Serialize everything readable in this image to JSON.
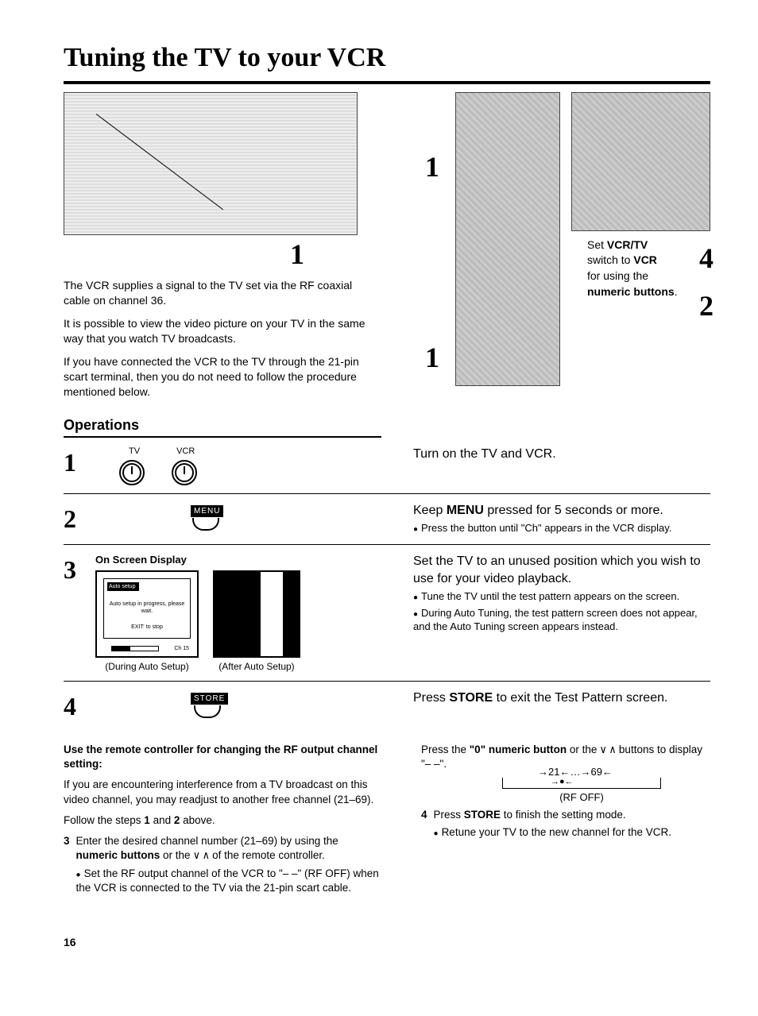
{
  "title": "Tuning the TV to your VCR",
  "intro": {
    "p1": "The VCR supplies a signal to the TV set via the RF coaxial cable on channel 36.",
    "p2": "It is possible to view the video picture on your TV in the same way that you watch TV broadcasts.",
    "p3": "If you have connected the VCR to the TV through the 21-pin scart terminal, then you do not need to follow the procedure mentioned below."
  },
  "side_note": {
    "line1_pre": "Set ",
    "line1_bold": "VCR/TV",
    "line2_pre": "switch to ",
    "line2_bold": "VCR",
    "line3": "for using the",
    "line4_bold": "numeric buttons",
    "line4_post": "."
  },
  "ops_header": "Operations",
  "steps": {
    "s1": {
      "num": "1",
      "tv": "TV",
      "vcr": "VCR",
      "text": "Turn on the TV and VCR."
    },
    "s2": {
      "num": "2",
      "btn": "MENU",
      "text_pre": "Keep ",
      "text_bold": "MENU",
      "text_post": " pressed for 5 seconds or more.",
      "note": "Press the button until \"Ch\" appears in the VCR display."
    },
    "s3": {
      "num": "3",
      "osd_title": "On Screen Display",
      "osd1_t1": "Auto setup",
      "osd1_t2": "Auto setup in progress, please wait.",
      "osd1_t3": "EXIT: to stop",
      "osd1_ch": "Ch 15",
      "cap1": "(During Auto Setup)",
      "cap2": "(After Auto Setup)",
      "text": "Set the TV to an unused position which you wish to use for your video playback.",
      "note1": "Tune the TV until the test pattern appears on the screen.",
      "note2": "During Auto Tuning, the test pattern screen does not appear, and the Auto Tuning screen appears instead."
    },
    "s4": {
      "num": "4",
      "btn": "STORE",
      "text_pre": "Press ",
      "text_bold": "STORE",
      "text_post": " to exit the Test Pattern screen."
    }
  },
  "lower_left": {
    "heading": "Use the remote controller for changing the RF output channel setting:",
    "p1": "If you are encountering interference from a TV broadcast on this video channel, you may readjust to another free channel (21–69).",
    "p2_pre": "Follow the steps ",
    "p2_b1": "1",
    "p2_mid": " and ",
    "p2_b2": "2",
    "p2_post": " above.",
    "item3_num": "3",
    "item3_pre": "Enter the desired channel number (21–69) by using the ",
    "item3_bold": "numeric buttons",
    "item3_mid": " or the ",
    "item3_post": " of the remote controller.",
    "item3_sub": "Set the RF output channel of the VCR to \"– –\" (RF OFF) when the VCR is connected to the TV via the 21-pin scart cable."
  },
  "lower_right": {
    "p1_pre": "Press the ",
    "p1_b1": "\"0\" numeric button",
    "p1_mid": " or the ",
    "p1_post": " buttons to display \"– –\".",
    "diagram_top": "→21←…→69←",
    "diagram_bot": "(RF OFF)",
    "item4_num": "4",
    "item4_pre": "Press ",
    "item4_bold": "STORE",
    "item4_post": " to finish the setting mode.",
    "item4_sub": "Retune your TV to the new channel for the VCR."
  },
  "page_num": "16",
  "callouts": {
    "c1": "1",
    "c1b": "1",
    "c1c": "1",
    "c2": "2",
    "c4": "4"
  }
}
